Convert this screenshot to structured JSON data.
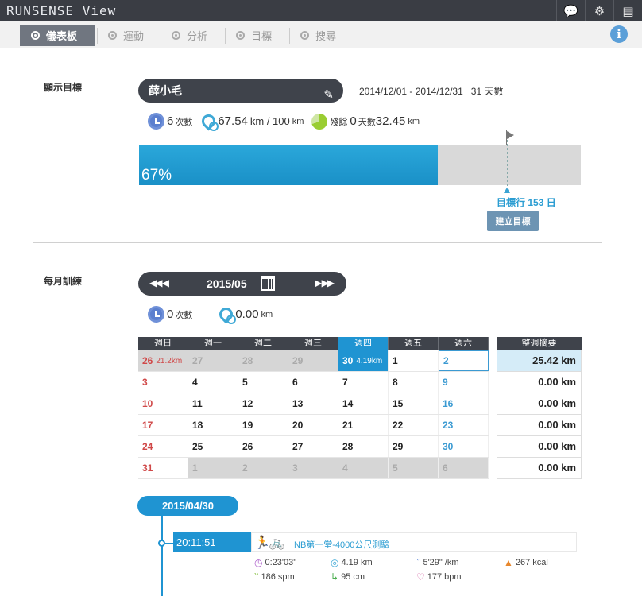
{
  "app": {
    "title": "RUNSENSE View",
    "toolbar_icons": [
      "chat-icon",
      "gear-icon",
      "exit-icon"
    ]
  },
  "nav": {
    "tabs": [
      {
        "label": "儀表板",
        "active": true
      },
      {
        "label": "運動",
        "active": false
      },
      {
        "label": "分析",
        "active": false
      },
      {
        "label": "目標",
        "active": false
      },
      {
        "label": "搜尋",
        "active": false
      }
    ],
    "info_icon": "i"
  },
  "goal": {
    "section_label": "顯示目標",
    "name": "薛小毛",
    "date_range": "2014/12/01 - 2014/12/31",
    "days": "31 天數",
    "count_value": "6",
    "count_unit": "次數",
    "distance_value": "67.54",
    "distance_unit": "km / 100",
    "distance_unit2": "km",
    "remain_label": "殘餘",
    "remain_days_value": "0",
    "remain_days_unit": "天數",
    "remain_km_value": "32.45",
    "remain_km_unit": "km",
    "progress_text": "67%",
    "progress_fraction": 0.6754,
    "goal_marker_text": "目標行 153 日",
    "create_button": "建立目標"
  },
  "monthly": {
    "section_label": "每月訓練",
    "month": "2015/05",
    "prev_buttons": "◀◀ ◀",
    "next_buttons": "▶ ▶▶",
    "count_value": "0",
    "count_unit": "次數",
    "distance_value": "0.00",
    "distance_unit": "km",
    "weekdays": [
      "週日",
      "週一",
      "週二",
      "週三",
      "週四",
      "週五",
      "週六"
    ],
    "highlight_weekday": 4,
    "weeks": [
      [
        {
          "d": "26",
          "km": "21.2km",
          "other": true
        },
        {
          "d": "27",
          "other": true
        },
        {
          "d": "28",
          "other": true
        },
        {
          "d": "29",
          "other": true
        },
        {
          "d": "30",
          "km": "4.19km",
          "today": true
        },
        {
          "d": "1"
        },
        {
          "d": "2",
          "sel": true
        }
      ],
      [
        {
          "d": "3"
        },
        {
          "d": "4"
        },
        {
          "d": "5"
        },
        {
          "d": "6"
        },
        {
          "d": "7"
        },
        {
          "d": "8"
        },
        {
          "d": "9"
        }
      ],
      [
        {
          "d": "10"
        },
        {
          "d": "11"
        },
        {
          "d": "12"
        },
        {
          "d": "13"
        },
        {
          "d": "14"
        },
        {
          "d": "15"
        },
        {
          "d": "16"
        }
      ],
      [
        {
          "d": "17"
        },
        {
          "d": "18"
        },
        {
          "d": "19"
        },
        {
          "d": "20"
        },
        {
          "d": "21"
        },
        {
          "d": "22"
        },
        {
          "d": "23"
        }
      ],
      [
        {
          "d": "24"
        },
        {
          "d": "25"
        },
        {
          "d": "26"
        },
        {
          "d": "27"
        },
        {
          "d": "28"
        },
        {
          "d": "29"
        },
        {
          "d": "30"
        }
      ],
      [
        {
          "d": "31"
        },
        {
          "d": "1",
          "other": true
        },
        {
          "d": "2",
          "other": true
        },
        {
          "d": "3",
          "other": true
        },
        {
          "d": "4",
          "other": true
        },
        {
          "d": "5",
          "other": true
        },
        {
          "d": "6",
          "other": true
        }
      ]
    ],
    "summary_header": "整週摘要",
    "summary": [
      "25.42 km",
      "0.00 km",
      "0.00 km",
      "0.00 km",
      "0.00 km",
      "0.00 km"
    ]
  },
  "timeline": {
    "date": "2015/04/30",
    "time": "20:11:51",
    "activity_title": "NB第一堂-4000公尺測驗",
    "metrics": {
      "duration": "0:23'03\"",
      "distance": "4.19 km",
      "pace": "5'29\" /km",
      "calories": "267 kcal",
      "cadence": "186 spm",
      "stride": "95 cm",
      "heart_rate": "177 bpm"
    }
  },
  "colors": {
    "accent": "#1f94d2",
    "dark": "#3f434b",
    "sunday": "#d04848",
    "saturday": "#3b9ad2"
  }
}
